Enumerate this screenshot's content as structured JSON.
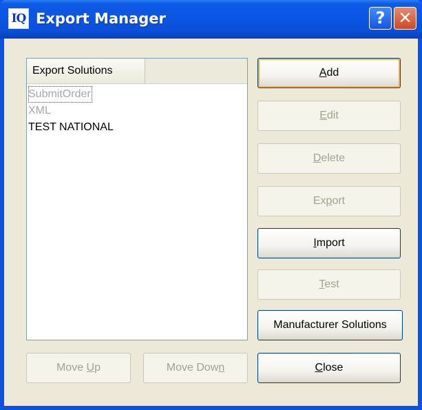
{
  "window": {
    "title": "Export Manager",
    "app_icon_text": "IQ",
    "help_glyph": "?",
    "close_glyph": "✕"
  },
  "list": {
    "column_header": "Export Solutions",
    "items": [
      {
        "label": "SubmitOrder",
        "enabled": false,
        "focused": true
      },
      {
        "label": "XML",
        "enabled": false,
        "focused": false
      },
      {
        "label": "TEST NATIONAL",
        "enabled": true,
        "focused": false
      }
    ]
  },
  "buttons": {
    "add": {
      "label": "Add",
      "enabled": true
    },
    "edit": {
      "label": "Edit",
      "enabled": false
    },
    "delete": {
      "label": "Delete",
      "enabled": false
    },
    "export": {
      "label": "Export",
      "enabled": false
    },
    "import": {
      "label": "Import",
      "enabled": true
    },
    "test": {
      "label": "Test",
      "enabled": false
    },
    "manufacturer": {
      "label": "Manufacturer Solutions",
      "enabled": true
    },
    "close": {
      "label": "Close",
      "enabled": true
    },
    "move_up": {
      "label": "Move Up",
      "enabled": false
    },
    "move_down": {
      "label": "Move Down",
      "enabled": false
    }
  },
  "colors": {
    "titlebar": "#0b55e4",
    "dialog_bg": "#ece9d8",
    "default_button_highlight": "#f8b14a",
    "disabled_text": "#a3a190"
  }
}
